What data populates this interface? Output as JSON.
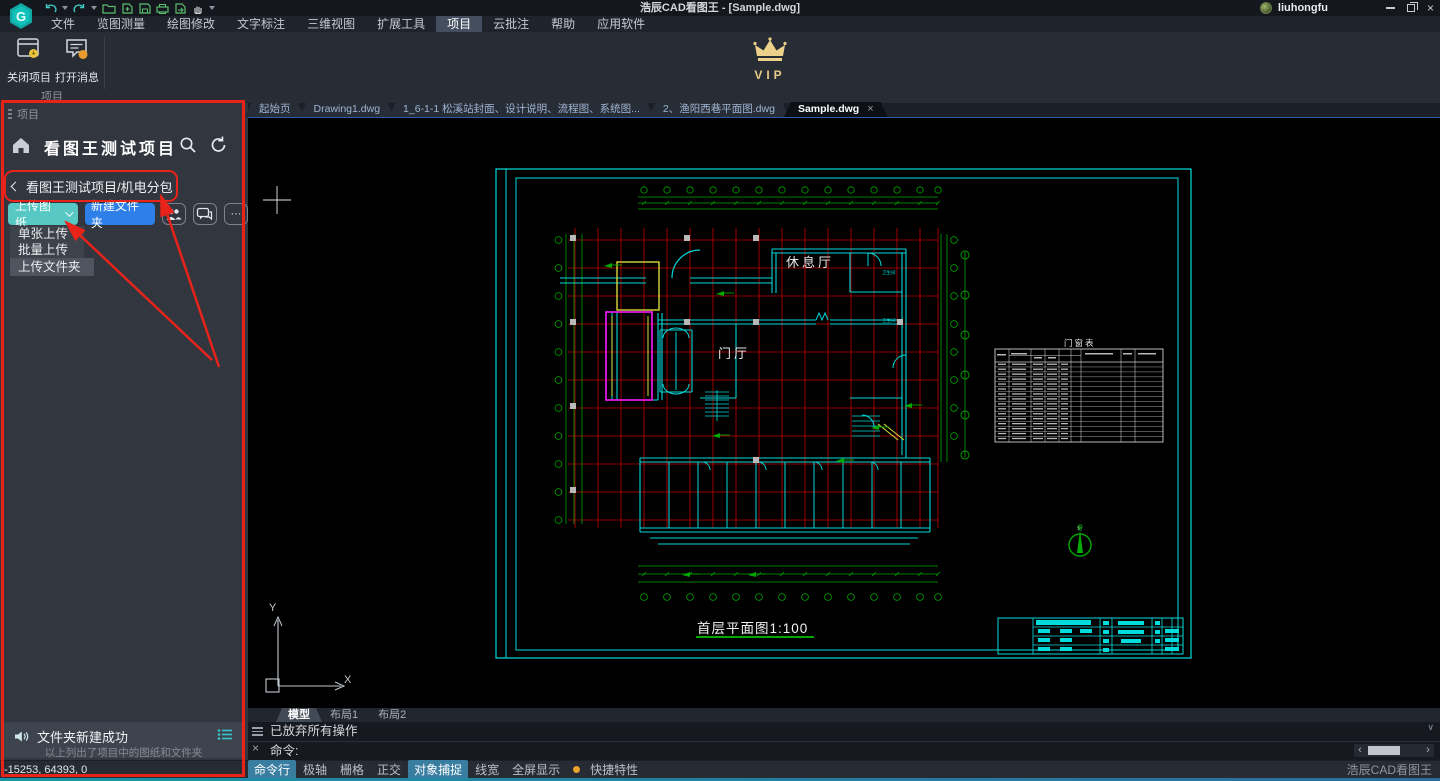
{
  "window": {
    "title": "浩辰CAD看图王 - [Sample.dwg]",
    "user": "liuhongfu"
  },
  "menu": {
    "items": [
      "文件",
      "览图测量",
      "绘图修改",
      "文字标注",
      "三维视图",
      "扩展工具",
      "项目",
      "云批注",
      "帮助",
      "应用软件"
    ],
    "active": "项目"
  },
  "ribbon": {
    "close_project": "关闭项目",
    "open_message": "打开消息",
    "group_label": "项目",
    "vip": "VIP"
  },
  "doc_tabs": [
    "起始页",
    "Drawing1.dwg",
    "1_6-1-1 松溪站封面、设计说明、流程图、系统图...",
    "2、渔阳西巷平面图.dwg",
    "Sample.dwg"
  ],
  "sidebar": {
    "panel_title": "项目",
    "project_title": "看图王测试项目",
    "breadcrumb": "看图王测试项目/机电分包",
    "upload_drawing": "上传图纸",
    "new_folder": "新建文件夹",
    "more": "···",
    "dropdown": [
      "单张上传",
      "批量上传",
      "上传文件夹"
    ],
    "toast_title": "文件夹新建成功",
    "toast_subtitle": "以上列出了项目中的图纸和文件夹"
  },
  "canvas": {
    "labels": {
      "rest_hall": "休息厅",
      "foyer": "门厅",
      "washroom1": "卫生间",
      "washroom2": "卫生间",
      "plan_title": "首层平面图1:100",
      "schedule_title": "门窗表",
      "north": "北",
      "ucs_x": "X",
      "ucs_y": "Y"
    },
    "colors": {
      "frame": "#00dcdc",
      "grid": "#c40000",
      "dims": "#00a800",
      "walls": "#00d8d8",
      "highlight_magenta": "#e018e0",
      "highlight_yellow": "#d8d83c",
      "table": "#cfcfcf"
    }
  },
  "layout_tabs": [
    "模型",
    "布局1",
    "布局2"
  ],
  "command": {
    "history": "已放弃所有操作",
    "prompt": "命令:"
  },
  "status": {
    "coords": "-15253, 64393, 0",
    "toggles": [
      "命令行",
      "极轴",
      "栅格",
      "正交",
      "对象捕捉",
      "线宽",
      "全屏显示",
      "快捷特性"
    ],
    "brand": "浩辰CAD看图王"
  },
  "icons": {
    "close": "×",
    "scroll_down": "∨",
    "scroll_left": "‹",
    "scroll_right": "›"
  },
  "annotation": {
    "color": "#e8231a"
  }
}
